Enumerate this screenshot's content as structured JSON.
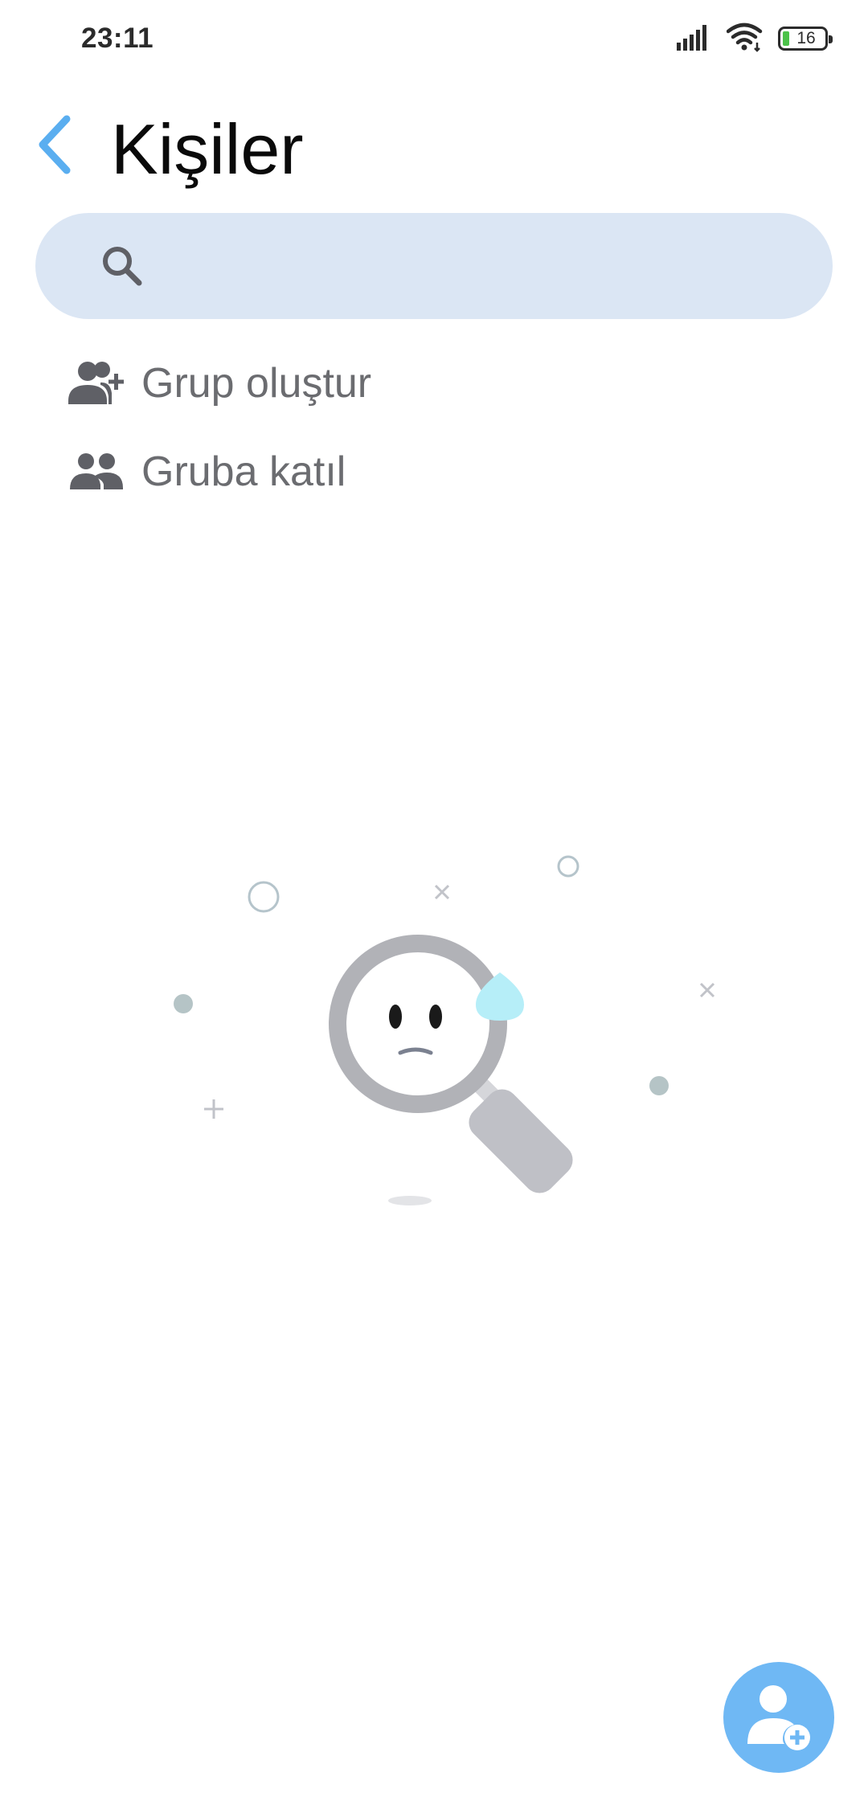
{
  "status_bar": {
    "time": "23:11",
    "battery_level": "16",
    "icons": [
      "signal-icon",
      "wifi-icon",
      "battery-icon"
    ]
  },
  "header": {
    "title": "Kişiler",
    "back_icon": "chevron-left-icon"
  },
  "search": {
    "placeholder": "",
    "value": "",
    "icon": "search-icon"
  },
  "actions": [
    {
      "label": "Grup oluştur",
      "icon": "group-add-icon"
    },
    {
      "label": "Gruba katıl",
      "icon": "group-icon"
    }
  ],
  "empty_state": {
    "illustration": "magnifier-sad-face-illustration"
  },
  "fab": {
    "icon": "add-contact-icon"
  },
  "colors": {
    "accent": "#5aaef0",
    "search_bg": "#dbe6f4",
    "action_text": "#6b6c70",
    "fab_bg": "#6fb8f4"
  }
}
